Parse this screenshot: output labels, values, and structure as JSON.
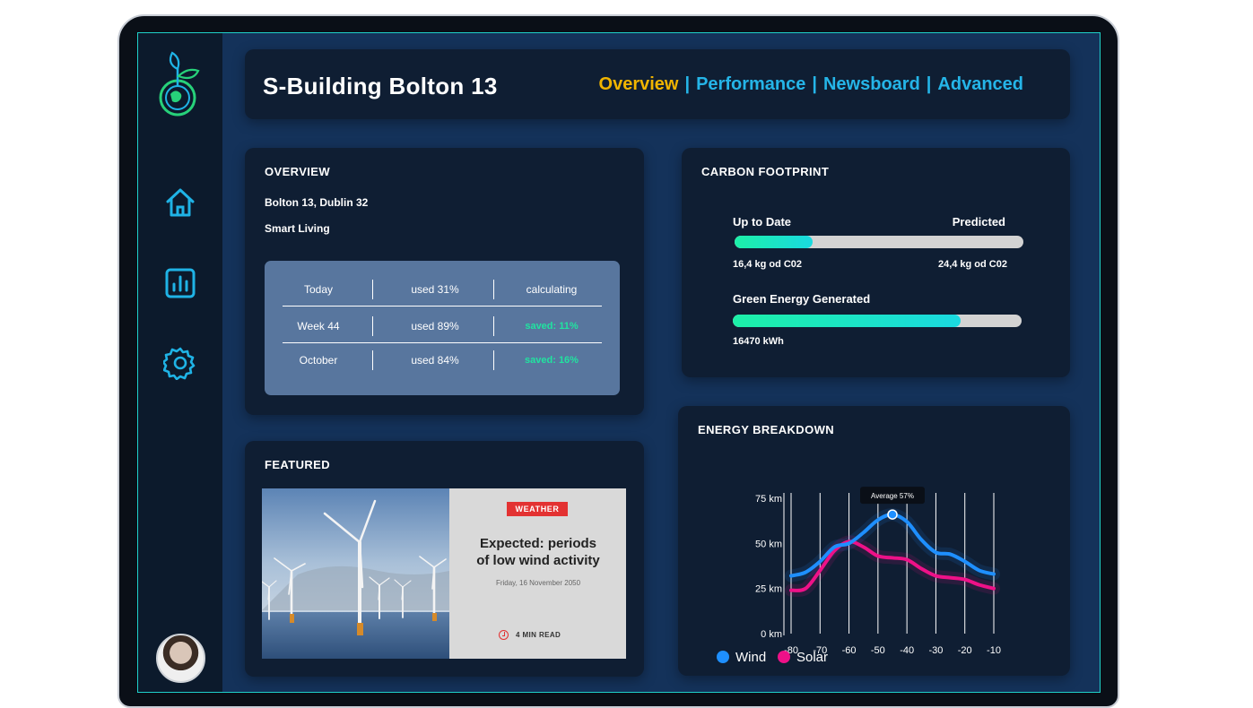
{
  "app": {
    "title": "S-Building Bolton 13"
  },
  "nav": {
    "tabs": [
      {
        "label": "Overview",
        "active": true
      },
      {
        "label": "Performance",
        "active": false
      },
      {
        "label": "Newsboard",
        "active": false
      },
      {
        "label": "Advanced",
        "active": false
      }
    ],
    "separator": "|"
  },
  "sidebar": {
    "icons": [
      "leaf-globe-logo",
      "home-icon",
      "chart-icon",
      "gear-icon"
    ],
    "accent": "#1fb3e6"
  },
  "overview": {
    "title": "OVERVIEW",
    "address": "Bolton 13, Dublin 32",
    "tagline": "Smart Living",
    "rows": [
      {
        "period": "Today",
        "usage": "used 31%",
        "status": "calculating",
        "saved": false
      },
      {
        "period": "Week 44",
        "usage": "used 89%",
        "status": "saved: 11%",
        "saved": true
      },
      {
        "period": "October",
        "usage": "used 84%",
        "status": "saved: 16%",
        "saved": true
      }
    ]
  },
  "carbon": {
    "title": "CARBON FOOTPRINT",
    "up_to_date_label": "Up to Date",
    "predicted_label": "Predicted",
    "up_to_date_value": "16,4 kg od C02",
    "predicted_value": "24,4 kg od C02",
    "footprint_fraction": 0.27,
    "green_label": "Green Energy Generated",
    "green_value": "16470 kWh",
    "green_fraction": 0.79
  },
  "featured": {
    "title": "FEATURED",
    "badge": "WEATHER",
    "headline_line1": "Expected: periods",
    "headline_line2": "of low wind activity",
    "date": "Friday, 16 November 2050",
    "read_time": "4 MIN READ"
  },
  "energy": {
    "title": "ENERGY BREAKDOWN"
  },
  "chart_data": {
    "type": "line",
    "title": "ENERGY BREAKDOWN",
    "x": [
      -80,
      -70,
      -60,
      -50,
      -40,
      -30,
      -20,
      -10
    ],
    "xticks": [
      "-80",
      "-70",
      "-60",
      "-50",
      "-40",
      "-30",
      "-20",
      "-10"
    ],
    "yticks": [
      "0 km",
      "25 km",
      "50 km",
      "75 km"
    ],
    "ylim": [
      0,
      75
    ],
    "xlim": [
      -80,
      -10
    ],
    "series": [
      {
        "name": "Wind",
        "color": "#1e8fff",
        "x": [
          -80,
          -75,
          -70,
          -65,
          -60,
          -55,
          -50,
          -45,
          -40,
          -35,
          -30,
          -25,
          -20,
          -15,
          -10
        ],
        "values": [
          32,
          34,
          40,
          48,
          50,
          56,
          63,
          66,
          62,
          52,
          45,
          44,
          40,
          35,
          33
        ]
      },
      {
        "name": "Solar",
        "color": "#ee1188",
        "x": [
          -80,
          -75,
          -70,
          -65,
          -60,
          -55,
          -50,
          -45,
          -40,
          -35,
          -30,
          -25,
          -20,
          -15,
          -10
        ],
        "values": [
          24,
          25,
          35,
          46,
          51,
          48,
          43,
          42,
          41,
          36,
          32,
          31,
          30,
          27,
          25
        ]
      }
    ],
    "annotation": {
      "text": "Average 57%",
      "x": -45,
      "series": "Wind"
    },
    "legend": [
      "Wind",
      "Solar"
    ],
    "legend_position": "bottom-left",
    "grid": "vertical"
  }
}
